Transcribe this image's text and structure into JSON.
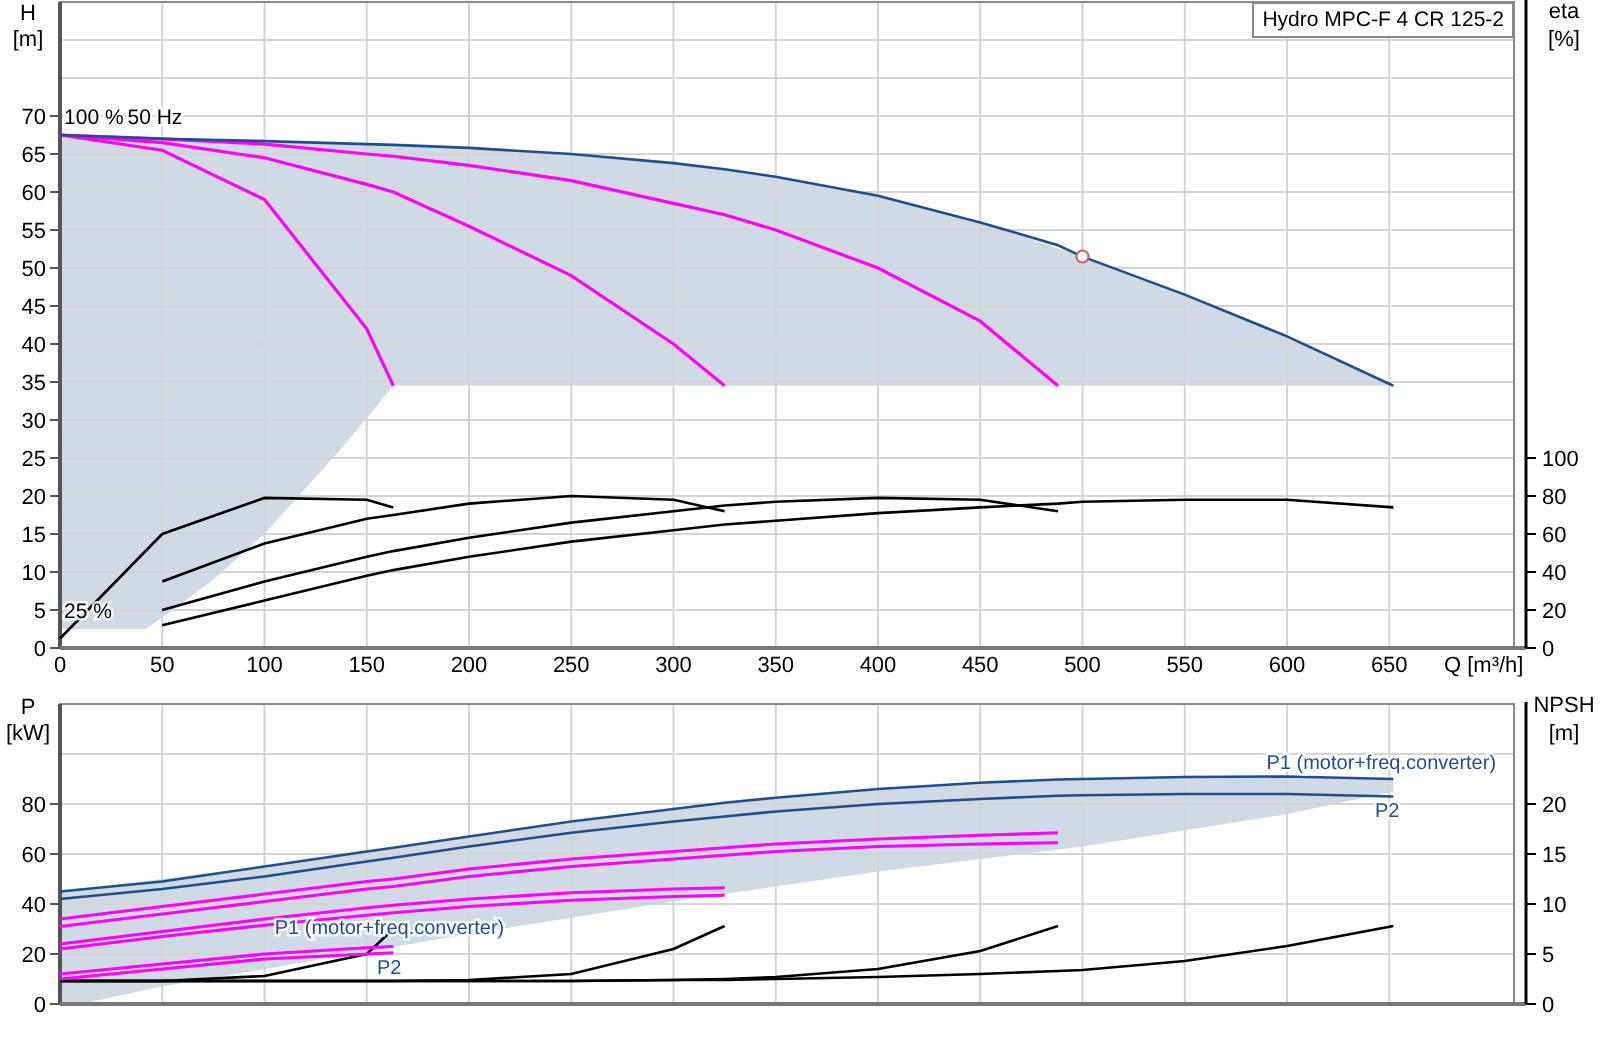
{
  "head_chart": {
    "legend": "Hydro MPC-F 4 CR 125-2",
    "left_axis": {
      "name": "H",
      "unit": "[m]"
    },
    "right_axis": {
      "name": "eta",
      "unit": "[%]"
    },
    "curve_labels": [
      "100 %",
      "50 Hz",
      "25 %"
    ],
    "chart_data": {
      "type": "line",
      "xlabel": "Q [m³/h]",
      "grid": true,
      "x": [
        0,
        50,
        100,
        150,
        163,
        200,
        250,
        300,
        325,
        350,
        400,
        450,
        488,
        500,
        550,
        600,
        652
      ],
      "series": [
        {
          "color": "#1f4e8c",
          "values": [
            67.5,
            67,
            66.7,
            66.3,
            66.2,
            65.8,
            65,
            63.8,
            63,
            62,
            59.5,
            56,
            53,
            51.5,
            46.5,
            41,
            34.5
          ]
        },
        {
          "color": "#ff00ff",
          "values": [
            67.5,
            65.5,
            59,
            42,
            34.5,
            null,
            null,
            null,
            null,
            null,
            null,
            null,
            null,
            null,
            null,
            null,
            null
          ]
        },
        {
          "color": "#ff00ff",
          "values": [
            67.5,
            66.5,
            64.5,
            61,
            60,
            55.5,
            49,
            40,
            34.5,
            null,
            null,
            null,
            null,
            null,
            null,
            null,
            null
          ]
        },
        {
          "color": "#ff00ff",
          "values": [
            67.5,
            67,
            66.3,
            65,
            64.7,
            63.5,
            61.5,
            58.5,
            57,
            55,
            50,
            43,
            34.5,
            null,
            null,
            null,
            null
          ]
        },
        {
          "color": "#000000",
          "axis": "y2",
          "values": [
            5,
            60,
            79,
            78,
            74,
            null,
            null,
            null,
            null,
            null,
            null,
            null,
            null,
            null,
            null,
            null,
            null
          ]
        },
        {
          "color": "#000000",
          "axis": "y2",
          "values": [
            null,
            35,
            55,
            68,
            70,
            76,
            80,
            78,
            72,
            null,
            null,
            null,
            null,
            null,
            null,
            null,
            null
          ]
        },
        {
          "color": "#000000",
          "axis": "y2",
          "values": [
            null,
            20,
            35,
            48,
            51,
            58,
            66,
            72,
            75,
            77,
            79,
            78,
            72,
            null,
            null,
            null,
            null
          ]
        },
        {
          "color": "#000000",
          "axis": "y2",
          "values": [
            null,
            12,
            25,
            38,
            41,
            48,
            56,
            62,
            65,
            67,
            71,
            74,
            76,
            77,
            78,
            78,
            74
          ]
        }
      ],
      "xlim": [
        0,
        711
      ],
      "ylim": [
        0,
        85
      ],
      "y2lim": [
        0,
        340
      ],
      "xticks": [
        0,
        50,
        100,
        150,
        200,
        250,
        300,
        350,
        400,
        450,
        500,
        550,
        600,
        650
      ],
      "yticks": [
        0,
        5,
        10,
        15,
        20,
        25,
        30,
        35,
        40,
        45,
        50,
        55,
        60,
        65,
        70
      ],
      "y2ticks": [
        0,
        20,
        40,
        60,
        80,
        100
      ]
    }
  },
  "power_chart": {
    "left_axis": {
      "name": "P",
      "unit": "[kW]"
    },
    "right_axis": {
      "name": "NPSH",
      "unit": "[m]"
    },
    "curve_labels": [
      "P1 (motor+freq.converter)",
      "P2",
      "P1 (motor+freq.converter)",
      "P2"
    ],
    "chart_data": {
      "type": "line",
      "grid": true,
      "x": [
        0,
        50,
        100,
        150,
        163,
        200,
        250,
        300,
        325,
        350,
        400,
        450,
        488,
        500,
        550,
        600,
        652
      ],
      "series": [
        {
          "color": "#1f4e8c",
          "values": [
            45,
            49,
            55,
            61,
            62.5,
            67,
            73,
            78,
            80.5,
            82.5,
            86,
            88.5,
            89.8,
            90,
            90.8,
            91,
            90
          ]
        },
        {
          "color": "#1f4e8c",
          "values": [
            42,
            46,
            51,
            57,
            58.5,
            63,
            68.5,
            73,
            75,
            77,
            80,
            82,
            83.3,
            83.5,
            84,
            84,
            83
          ]
        },
        {
          "color": "#ff00ff",
          "values": [
            34,
            39,
            44,
            49,
            50,
            54,
            58,
            61,
            62.5,
            64,
            66,
            67.5,
            68.5,
            null,
            null,
            null,
            null
          ]
        },
        {
          "color": "#ff00ff",
          "values": [
            31,
            36,
            41,
            46,
            47,
            51,
            55,
            58,
            59.5,
            61,
            63,
            64,
            64.5,
            null,
            null,
            null,
            null
          ]
        },
        {
          "color": "#ff00ff",
          "values": [
            24,
            29,
            34,
            38.5,
            39.5,
            42,
            44.5,
            46,
            46.5,
            null,
            null,
            null,
            null,
            null,
            null,
            null,
            null
          ]
        },
        {
          "color": "#ff00ff",
          "values": [
            22,
            27,
            31.5,
            35.5,
            36.5,
            39,
            41.5,
            43,
            43.5,
            null,
            null,
            null,
            null,
            null,
            null,
            null,
            null
          ]
        },
        {
          "color": "#ff00ff",
          "values": [
            12,
            16,
            20,
            22.5,
            23,
            null,
            null,
            null,
            null,
            null,
            null,
            null,
            null,
            null,
            null,
            null,
            null
          ]
        },
        {
          "color": "#ff00ff",
          "values": [
            10,
            14,
            18,
            20,
            20.5,
            null,
            null,
            null,
            null,
            null,
            null,
            null,
            null,
            null,
            null,
            null,
            null
          ]
        },
        {
          "color": "#000000",
          "axis": "y2",
          "values": [
            2.3,
            2.3,
            2.8,
            5,
            7.5,
            null,
            null,
            null,
            null,
            null,
            null,
            null,
            null,
            null,
            null,
            null,
            null
          ]
        },
        {
          "color": "#000000",
          "axis": "y2",
          "values": [
            2.3,
            2.3,
            2.3,
            2.3,
            2.3,
            2.4,
            3,
            5.5,
            7.8,
            null,
            null,
            null,
            null,
            null,
            null,
            null,
            null
          ]
        },
        {
          "color": "#000000",
          "axis": "y2",
          "values": [
            2.3,
            2.3,
            2.3,
            2.3,
            2.3,
            2.3,
            2.3,
            2.4,
            2.5,
            2.7,
            3.5,
            5.3,
            7.8,
            null,
            null,
            null,
            null
          ]
        },
        {
          "color": "#000000",
          "axis": "y2",
          "values": [
            2.3,
            2.3,
            2.3,
            2.3,
            2.3,
            2.3,
            2.3,
            2.4,
            2.4,
            2.5,
            2.7,
            3,
            3.3,
            3.4,
            4.3,
            5.8,
            7.8
          ]
        }
      ],
      "xlim": [
        0,
        711
      ],
      "ylim": [
        0,
        120
      ],
      "y2lim": [
        0,
        30
      ],
      "yticks": [
        0,
        20,
        40,
        60,
        80
      ],
      "y2ticks": [
        0,
        5,
        10,
        15,
        20
      ]
    }
  }
}
